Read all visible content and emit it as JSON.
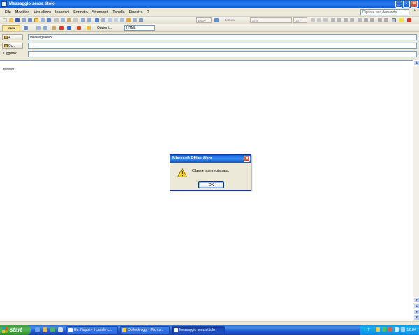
{
  "window": {
    "title": "Messaggio senza titolo"
  },
  "menu": {
    "items": [
      "File",
      "Modifica",
      "Visualizza",
      "Inserisci",
      "Formato",
      "Strumenti",
      "Tabella",
      "Finestra",
      "?"
    ],
    "help_placeholder": "Digitare una domanda."
  },
  "toolbar": {
    "zoom": "100%",
    "reading": "Lettura",
    "font": "Arial",
    "font_size": "10"
  },
  "mail_toolbar": {
    "send_label": "Invia",
    "options_label": "Opzioni...",
    "format_value": "HTML"
  },
  "address": {
    "to_label": "A...",
    "to_value": "lallalal@lalalo",
    "cc_label": "Cc...",
    "cc_value": "",
    "subject_label": "Oggetto:",
    "subject_value": ""
  },
  "document": {
    "body_text": "eeeee"
  },
  "dialog": {
    "title": "Microsoft Office Word",
    "message": "Classe non registrata.",
    "ok_label": "OK"
  },
  "taskbar": {
    "start_label": "start",
    "tasks": [
      "Re: Napoli - il canale c...",
      "Outlook oggi - Micros...",
      "Messaggio senza titolo"
    ],
    "lang": "IT",
    "clock": "12.04"
  },
  "colors": {
    "titlebar": "#0a5fd8",
    "taskbar": "#245edb",
    "start": "#3e9b3e"
  }
}
